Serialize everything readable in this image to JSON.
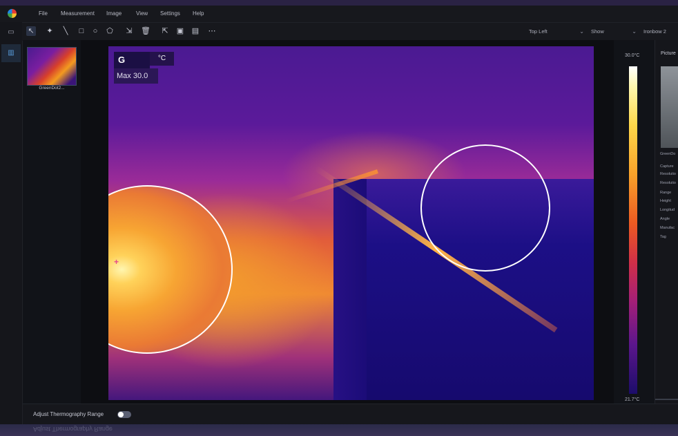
{
  "menubar": {
    "items": [
      "File",
      "Measurement",
      "Image",
      "View",
      "Settings",
      "Help"
    ]
  },
  "toolbar": {
    "tools": [
      "select-arrow",
      "spot-point",
      "line",
      "rectangle",
      "circle",
      "polygon",
      "auto-detect",
      "delete",
      "export",
      "save",
      "save-as",
      "more"
    ],
    "position_select": "Top Left",
    "show_select": "Show",
    "palette_select": "Ironbow 2"
  },
  "filelist": {
    "thumbnail_name": "GreenDot2..."
  },
  "thermal_overlay": {
    "label": "G",
    "unit": "°C",
    "max_text": "Max 30.0"
  },
  "scale": {
    "max": "30.0°C",
    "min": "21.7°C",
    "palette_colors": [
      "#ffffff",
      "#ffd84a",
      "#f9a22a",
      "#ec5a22",
      "#a31f78",
      "#1c0d6a"
    ]
  },
  "picture_panel": {
    "title": "Picture",
    "file_name": "GreenDo",
    "labels": [
      "Capture",
      "Resolutio",
      "Resolutio",
      "Range",
      "Height",
      "Longitud",
      "Angle",
      "Manufac",
      "Tag"
    ]
  },
  "bottombar": {
    "adjust_label": "Adjust Thermography Range",
    "adjust_enabled": false
  },
  "reflection": {
    "text": "Adjust Thermography Range"
  }
}
